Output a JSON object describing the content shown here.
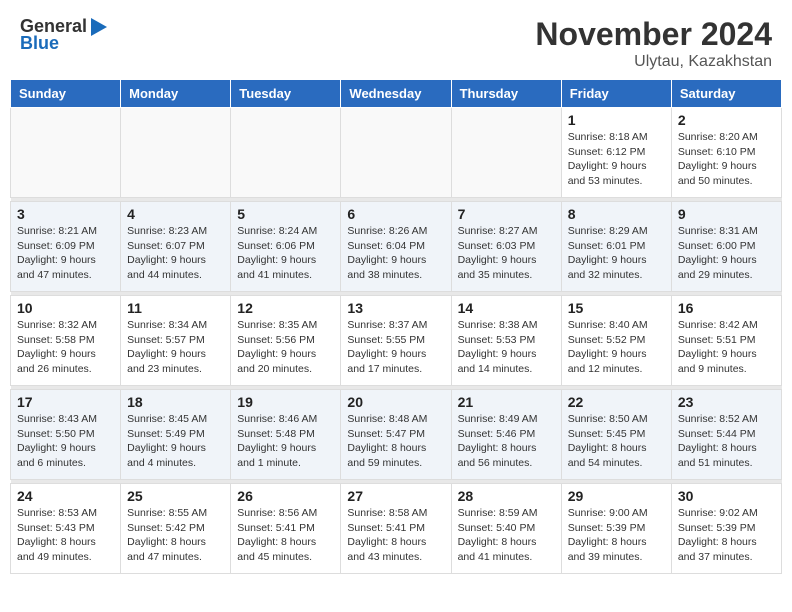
{
  "header": {
    "logo_line1": "General",
    "logo_line2": "Blue",
    "month_title": "November 2024",
    "location": "Ulytau, Kazakhstan"
  },
  "days_of_week": [
    "Sunday",
    "Monday",
    "Tuesday",
    "Wednesday",
    "Thursday",
    "Friday",
    "Saturday"
  ],
  "weeks": [
    [
      {
        "day": "",
        "info": ""
      },
      {
        "day": "",
        "info": ""
      },
      {
        "day": "",
        "info": ""
      },
      {
        "day": "",
        "info": ""
      },
      {
        "day": "",
        "info": ""
      },
      {
        "day": "1",
        "info": "Sunrise: 8:18 AM\nSunset: 6:12 PM\nDaylight: 9 hours\nand 53 minutes."
      },
      {
        "day": "2",
        "info": "Sunrise: 8:20 AM\nSunset: 6:10 PM\nDaylight: 9 hours\nand 50 minutes."
      }
    ],
    [
      {
        "day": "3",
        "info": "Sunrise: 8:21 AM\nSunset: 6:09 PM\nDaylight: 9 hours\nand 47 minutes."
      },
      {
        "day": "4",
        "info": "Sunrise: 8:23 AM\nSunset: 6:07 PM\nDaylight: 9 hours\nand 44 minutes."
      },
      {
        "day": "5",
        "info": "Sunrise: 8:24 AM\nSunset: 6:06 PM\nDaylight: 9 hours\nand 41 minutes."
      },
      {
        "day": "6",
        "info": "Sunrise: 8:26 AM\nSunset: 6:04 PM\nDaylight: 9 hours\nand 38 minutes."
      },
      {
        "day": "7",
        "info": "Sunrise: 8:27 AM\nSunset: 6:03 PM\nDaylight: 9 hours\nand 35 minutes."
      },
      {
        "day": "8",
        "info": "Sunrise: 8:29 AM\nSunset: 6:01 PM\nDaylight: 9 hours\nand 32 minutes."
      },
      {
        "day": "9",
        "info": "Sunrise: 8:31 AM\nSunset: 6:00 PM\nDaylight: 9 hours\nand 29 minutes."
      }
    ],
    [
      {
        "day": "10",
        "info": "Sunrise: 8:32 AM\nSunset: 5:58 PM\nDaylight: 9 hours\nand 26 minutes."
      },
      {
        "day": "11",
        "info": "Sunrise: 8:34 AM\nSunset: 5:57 PM\nDaylight: 9 hours\nand 23 minutes."
      },
      {
        "day": "12",
        "info": "Sunrise: 8:35 AM\nSunset: 5:56 PM\nDaylight: 9 hours\nand 20 minutes."
      },
      {
        "day": "13",
        "info": "Sunrise: 8:37 AM\nSunset: 5:55 PM\nDaylight: 9 hours\nand 17 minutes."
      },
      {
        "day": "14",
        "info": "Sunrise: 8:38 AM\nSunset: 5:53 PM\nDaylight: 9 hours\nand 14 minutes."
      },
      {
        "day": "15",
        "info": "Sunrise: 8:40 AM\nSunset: 5:52 PM\nDaylight: 9 hours\nand 12 minutes."
      },
      {
        "day": "16",
        "info": "Sunrise: 8:42 AM\nSunset: 5:51 PM\nDaylight: 9 hours\nand 9 minutes."
      }
    ],
    [
      {
        "day": "17",
        "info": "Sunrise: 8:43 AM\nSunset: 5:50 PM\nDaylight: 9 hours\nand 6 minutes."
      },
      {
        "day": "18",
        "info": "Sunrise: 8:45 AM\nSunset: 5:49 PM\nDaylight: 9 hours\nand 4 minutes."
      },
      {
        "day": "19",
        "info": "Sunrise: 8:46 AM\nSunset: 5:48 PM\nDaylight: 9 hours\nand 1 minute."
      },
      {
        "day": "20",
        "info": "Sunrise: 8:48 AM\nSunset: 5:47 PM\nDaylight: 8 hours\nand 59 minutes."
      },
      {
        "day": "21",
        "info": "Sunrise: 8:49 AM\nSunset: 5:46 PM\nDaylight: 8 hours\nand 56 minutes."
      },
      {
        "day": "22",
        "info": "Sunrise: 8:50 AM\nSunset: 5:45 PM\nDaylight: 8 hours\nand 54 minutes."
      },
      {
        "day": "23",
        "info": "Sunrise: 8:52 AM\nSunset: 5:44 PM\nDaylight: 8 hours\nand 51 minutes."
      }
    ],
    [
      {
        "day": "24",
        "info": "Sunrise: 8:53 AM\nSunset: 5:43 PM\nDaylight: 8 hours\nand 49 minutes."
      },
      {
        "day": "25",
        "info": "Sunrise: 8:55 AM\nSunset: 5:42 PM\nDaylight: 8 hours\nand 47 minutes."
      },
      {
        "day": "26",
        "info": "Sunrise: 8:56 AM\nSunset: 5:41 PM\nDaylight: 8 hours\nand 45 minutes."
      },
      {
        "day": "27",
        "info": "Sunrise: 8:58 AM\nSunset: 5:41 PM\nDaylight: 8 hours\nand 43 minutes."
      },
      {
        "day": "28",
        "info": "Sunrise: 8:59 AM\nSunset: 5:40 PM\nDaylight: 8 hours\nand 41 minutes."
      },
      {
        "day": "29",
        "info": "Sunrise: 9:00 AM\nSunset: 5:39 PM\nDaylight: 8 hours\nand 39 minutes."
      },
      {
        "day": "30",
        "info": "Sunrise: 9:02 AM\nSunset: 5:39 PM\nDaylight: 8 hours\nand 37 minutes."
      }
    ]
  ],
  "colors": {
    "header_bg": "#2a6bbf",
    "row_alt": "#f0f4f9",
    "row_normal": "#ffffff",
    "empty_bg": "#f9f9f9"
  }
}
